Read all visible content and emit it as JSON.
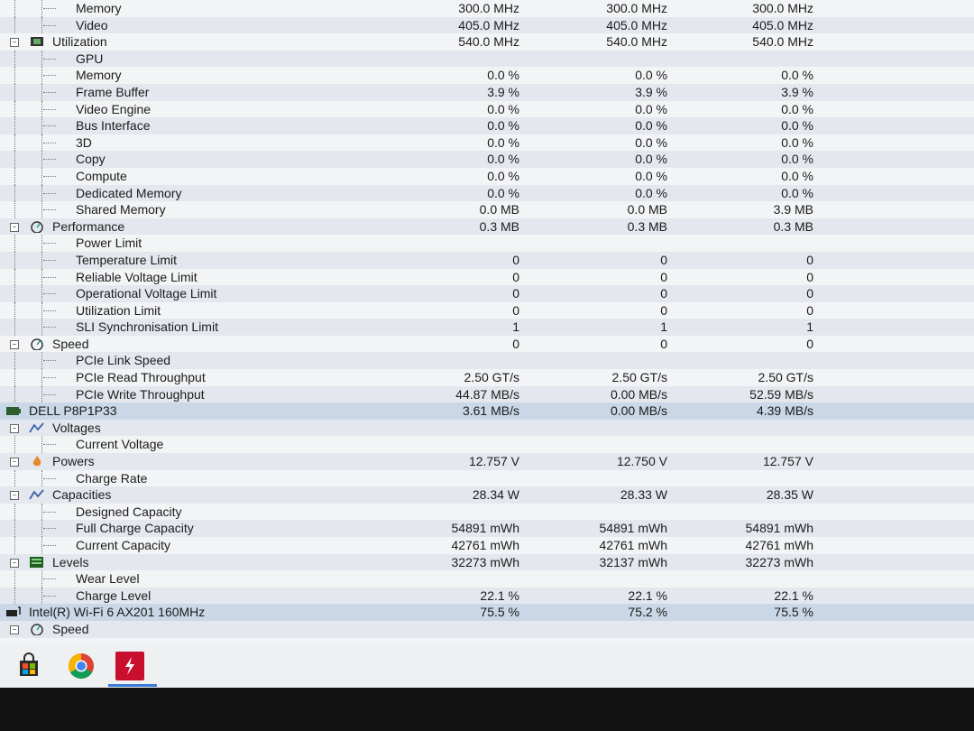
{
  "rows": [
    {
      "label": "Memory",
      "level": 2,
      "v": [
        "300.0 MHz",
        "300.0 MHz",
        "300.0 MHz"
      ]
    },
    {
      "label": "Video",
      "level": 2,
      "v": [
        "405.0 MHz",
        "405.0 MHz",
        "405.0 MHz"
      ]
    },
    {
      "label": "Utilization",
      "level": 1,
      "node": true,
      "icon": "chip-icon",
      "v": [
        "540.0 MHz",
        "540.0 MHz",
        "540.0 MHz"
      ]
    },
    {
      "label": "GPU",
      "level": 2,
      "v": [
        "",
        "",
        ""
      ]
    },
    {
      "label": "Memory",
      "level": 2,
      "v": [
        "0.0 %",
        "0.0 %",
        "0.0 %"
      ]
    },
    {
      "label": "Frame Buffer",
      "level": 2,
      "v": [
        "3.9 %",
        "3.9 %",
        "3.9 %"
      ]
    },
    {
      "label": "Video Engine",
      "level": 2,
      "v": [
        "0.0 %",
        "0.0 %",
        "0.0 %"
      ]
    },
    {
      "label": "Bus Interface",
      "level": 2,
      "v": [
        "0.0 %",
        "0.0 %",
        "0.0 %"
      ]
    },
    {
      "label": "3D",
      "level": 2,
      "v": [
        "0.0 %",
        "0.0 %",
        "0.0 %"
      ]
    },
    {
      "label": "Copy",
      "level": 2,
      "v": [
        "0.0 %",
        "0.0 %",
        "0.0 %"
      ]
    },
    {
      "label": "Compute",
      "level": 2,
      "v": [
        "0.0 %",
        "0.0 %",
        "0.0 %"
      ]
    },
    {
      "label": "Dedicated Memory",
      "level": 2,
      "v": [
        "0.0 %",
        "0.0 %",
        "0.0 %"
      ]
    },
    {
      "label": "Shared Memory",
      "level": 2,
      "v": [
        "0.0 MB",
        "0.0 MB",
        "3.9 MB"
      ]
    },
    {
      "label": "Performance",
      "level": 1,
      "node": true,
      "icon": "gauge-icon",
      "v": [
        "0.3 MB",
        "0.3 MB",
        "0.3 MB"
      ]
    },
    {
      "label": "Power Limit",
      "level": 2,
      "v": [
        "",
        "",
        ""
      ]
    },
    {
      "label": "Temperature Limit",
      "level": 2,
      "v": [
        "0",
        "0",
        "0"
      ]
    },
    {
      "label": "Reliable Voltage Limit",
      "level": 2,
      "v": [
        "0",
        "0",
        "0"
      ]
    },
    {
      "label": "Operational Voltage Limit",
      "level": 2,
      "v": [
        "0",
        "0",
        "0"
      ]
    },
    {
      "label": "Utilization Limit",
      "level": 2,
      "v": [
        "0",
        "0",
        "0"
      ]
    },
    {
      "label": "SLI Synchronisation Limit",
      "level": 2,
      "v": [
        "1",
        "1",
        "1"
      ]
    },
    {
      "label": "Speed",
      "level": 1,
      "node": true,
      "icon": "gauge-icon",
      "v": [
        "0",
        "0",
        "0"
      ]
    },
    {
      "label": "PCIe Link Speed",
      "level": 2,
      "v": [
        "",
        "",
        ""
      ]
    },
    {
      "label": "PCIe Read Throughput",
      "level": 2,
      "v": [
        "2.50 GT/s",
        "2.50 GT/s",
        "2.50 GT/s"
      ]
    },
    {
      "label": "PCIe Write Throughput",
      "level": 2,
      "v": [
        "44.87 MB/s",
        "0.00 MB/s",
        "52.59 MB/s"
      ]
    },
    {
      "label": "DELL P8P1P33",
      "level": 0,
      "icon": "battery-icon",
      "v": [
        "3.61 MB/s",
        "0.00 MB/s",
        "4.39 MB/s"
      ]
    },
    {
      "label": "Voltages",
      "level": 1,
      "node": true,
      "icon": "voltage-icon",
      "v": [
        "",
        "",
        ""
      ]
    },
    {
      "label": "Current Voltage",
      "level": 2,
      "v": [
        "",
        "",
        ""
      ]
    },
    {
      "label": "Powers",
      "level": 1,
      "node": true,
      "icon": "flame-icon",
      "v": [
        "12.757 V",
        "12.750 V",
        "12.757 V"
      ]
    },
    {
      "label": "Charge Rate",
      "level": 2,
      "v": [
        "",
        "",
        ""
      ]
    },
    {
      "label": "Capacities",
      "level": 1,
      "node": true,
      "icon": "voltage-icon",
      "v": [
        "28.34 W",
        "28.33 W",
        "28.35 W"
      ]
    },
    {
      "label": "Designed Capacity",
      "level": 2,
      "v": [
        "",
        "",
        ""
      ]
    },
    {
      "label": "Full Charge Capacity",
      "level": 2,
      "v": [
        "54891 mWh",
        "54891 mWh",
        "54891 mWh"
      ]
    },
    {
      "label": "Current Capacity",
      "level": 2,
      "v": [
        "42761 mWh",
        "42761 mWh",
        "42761 mWh"
      ]
    },
    {
      "label": "Levels",
      "level": 1,
      "node": true,
      "icon": "levels-icon",
      "v": [
        "32273 mWh",
        "32137 mWh",
        "32273 mWh"
      ]
    },
    {
      "label": "Wear Level",
      "level": 2,
      "v": [
        "",
        "",
        ""
      ]
    },
    {
      "label": "Charge Level",
      "level": 2,
      "v": [
        "22.1 %",
        "22.1 %",
        "22.1 %"
      ]
    },
    {
      "label": "Intel(R) Wi-Fi 6 AX201 160MHz",
      "level": 0,
      "icon": "network-icon",
      "v": [
        "75.5 %",
        "75.2 %",
        "75.5 %"
      ]
    },
    {
      "label": "Speed",
      "level": 1,
      "node": true,
      "icon": "gauge-icon",
      "v": [
        "",
        "",
        ""
      ]
    }
  ],
  "taskbar": [
    {
      "name": "store-app-icon",
      "glyph": "🛍"
    },
    {
      "name": "chrome-app-icon",
      "glyph": "●"
    },
    {
      "name": "hwinfo-app-icon",
      "glyph": "⚡"
    }
  ],
  "colors": {
    "accent": "#c9d7e6",
    "alt_row": "#e4e8ee",
    "chrome_red": "#db4437",
    "chrome_yellow": "#f4b400",
    "chrome_green": "#0f9d58",
    "chrome_blue": "#4285f4",
    "hwinfo_red": "#c8102e"
  }
}
